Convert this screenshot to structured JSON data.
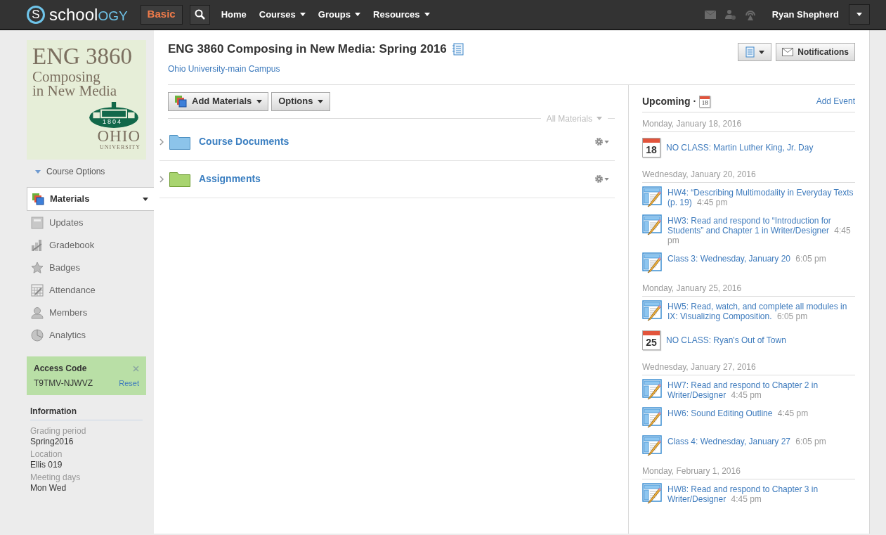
{
  "topbar": {
    "logo": {
      "mark": "S",
      "first": "school",
      "second": "OGY"
    },
    "mode": "Basic",
    "nav": [
      {
        "label": "Home",
        "dropdown": false
      },
      {
        "label": "Courses",
        "dropdown": true
      },
      {
        "label": "Groups",
        "dropdown": true
      },
      {
        "label": "Resources",
        "dropdown": true
      }
    ],
    "user": "Ryan Shepherd"
  },
  "sidebar": {
    "course_image": {
      "code": "ENG 3860",
      "title_lines": [
        "Composing",
        "in New Media"
      ],
      "year": "1804",
      "school": "OHIO",
      "school_sub": "UNIVERSITY"
    },
    "course_options": "Course Options",
    "menu": [
      {
        "label": "Materials",
        "selected": true
      },
      {
        "label": "Updates",
        "selected": false
      },
      {
        "label": "Gradebook",
        "selected": false
      },
      {
        "label": "Badges",
        "selected": false
      },
      {
        "label": "Attendance",
        "selected": false
      },
      {
        "label": "Members",
        "selected": false
      },
      {
        "label": "Analytics",
        "selected": false
      }
    ],
    "access_code": {
      "title": "Access Code",
      "code": "T9TMV-NJWVZ",
      "reset": "Reset"
    },
    "information": {
      "title": "Information",
      "fields": [
        {
          "label": "Grading period",
          "value": "Spring2016"
        },
        {
          "label": "Location",
          "value": "Ellis 019"
        },
        {
          "label": "Meeting days",
          "value": "Mon Wed"
        }
      ]
    }
  },
  "header": {
    "title": "ENG 3860 Composing in New Media: Spring 2016",
    "subtitle": "Ohio University-main Campus",
    "notifications": "Notifications"
  },
  "materials": {
    "add_button": "Add Materials",
    "options_button": "Options",
    "filter": "All Materials",
    "folders": [
      {
        "name": "Course Documents",
        "color": "#8cc4ea"
      },
      {
        "name": "Assignments",
        "color": "#a8d46f"
      }
    ]
  },
  "upcoming": {
    "title": "Upcoming",
    "separator": "·",
    "calendar_day": "18",
    "add_event": "Add Event",
    "days": [
      {
        "date": "Monday, January 18, 2016",
        "events": [
          {
            "kind": "event",
            "day": "18",
            "title": "NO CLASS: Martin Luther King, Jr. Day"
          }
        ]
      },
      {
        "date": "Wednesday, January 20, 2016",
        "events": [
          {
            "kind": "assignment",
            "title": "HW4: “Describing Multimodality in Everyday Texts (p. 19)",
            "time": "4:45 pm"
          },
          {
            "kind": "assignment",
            "title": "HW3: Read and respond to “Introduction for Students” and Chapter 1 in Writer/Designer",
            "time": "4:45 pm"
          },
          {
            "kind": "assignment",
            "title": "Class 3: Wednesday, January 20",
            "time": "6:05 pm"
          }
        ]
      },
      {
        "date": "Monday, January 25, 2016",
        "events": [
          {
            "kind": "assignment",
            "title": "HW5: Read, watch, and complete all modules in IX: Visualizing Composition.",
            "time": "6:05 pm"
          },
          {
            "kind": "event",
            "day": "25",
            "title": "NO CLASS: Ryan's Out of Town"
          }
        ]
      },
      {
        "date": "Wednesday, January 27, 2016",
        "events": [
          {
            "kind": "assignment",
            "title": "HW7: Read and respond to Chapter 2 in Writer/Designer",
            "time": "4:45 pm"
          },
          {
            "kind": "assignment",
            "title": "HW6: Sound Editing Outline",
            "time": "4:45 pm"
          },
          {
            "kind": "assignment",
            "title": "Class 4: Wednesday, January 27",
            "time": "6:05 pm"
          }
        ]
      },
      {
        "date": "Monday, February 1, 2016",
        "events": [
          {
            "kind": "assignment",
            "title": "HW8: Read and respond to Chapter 3 in Writer/Designer",
            "time": "4:45 pm"
          }
        ]
      }
    ]
  }
}
